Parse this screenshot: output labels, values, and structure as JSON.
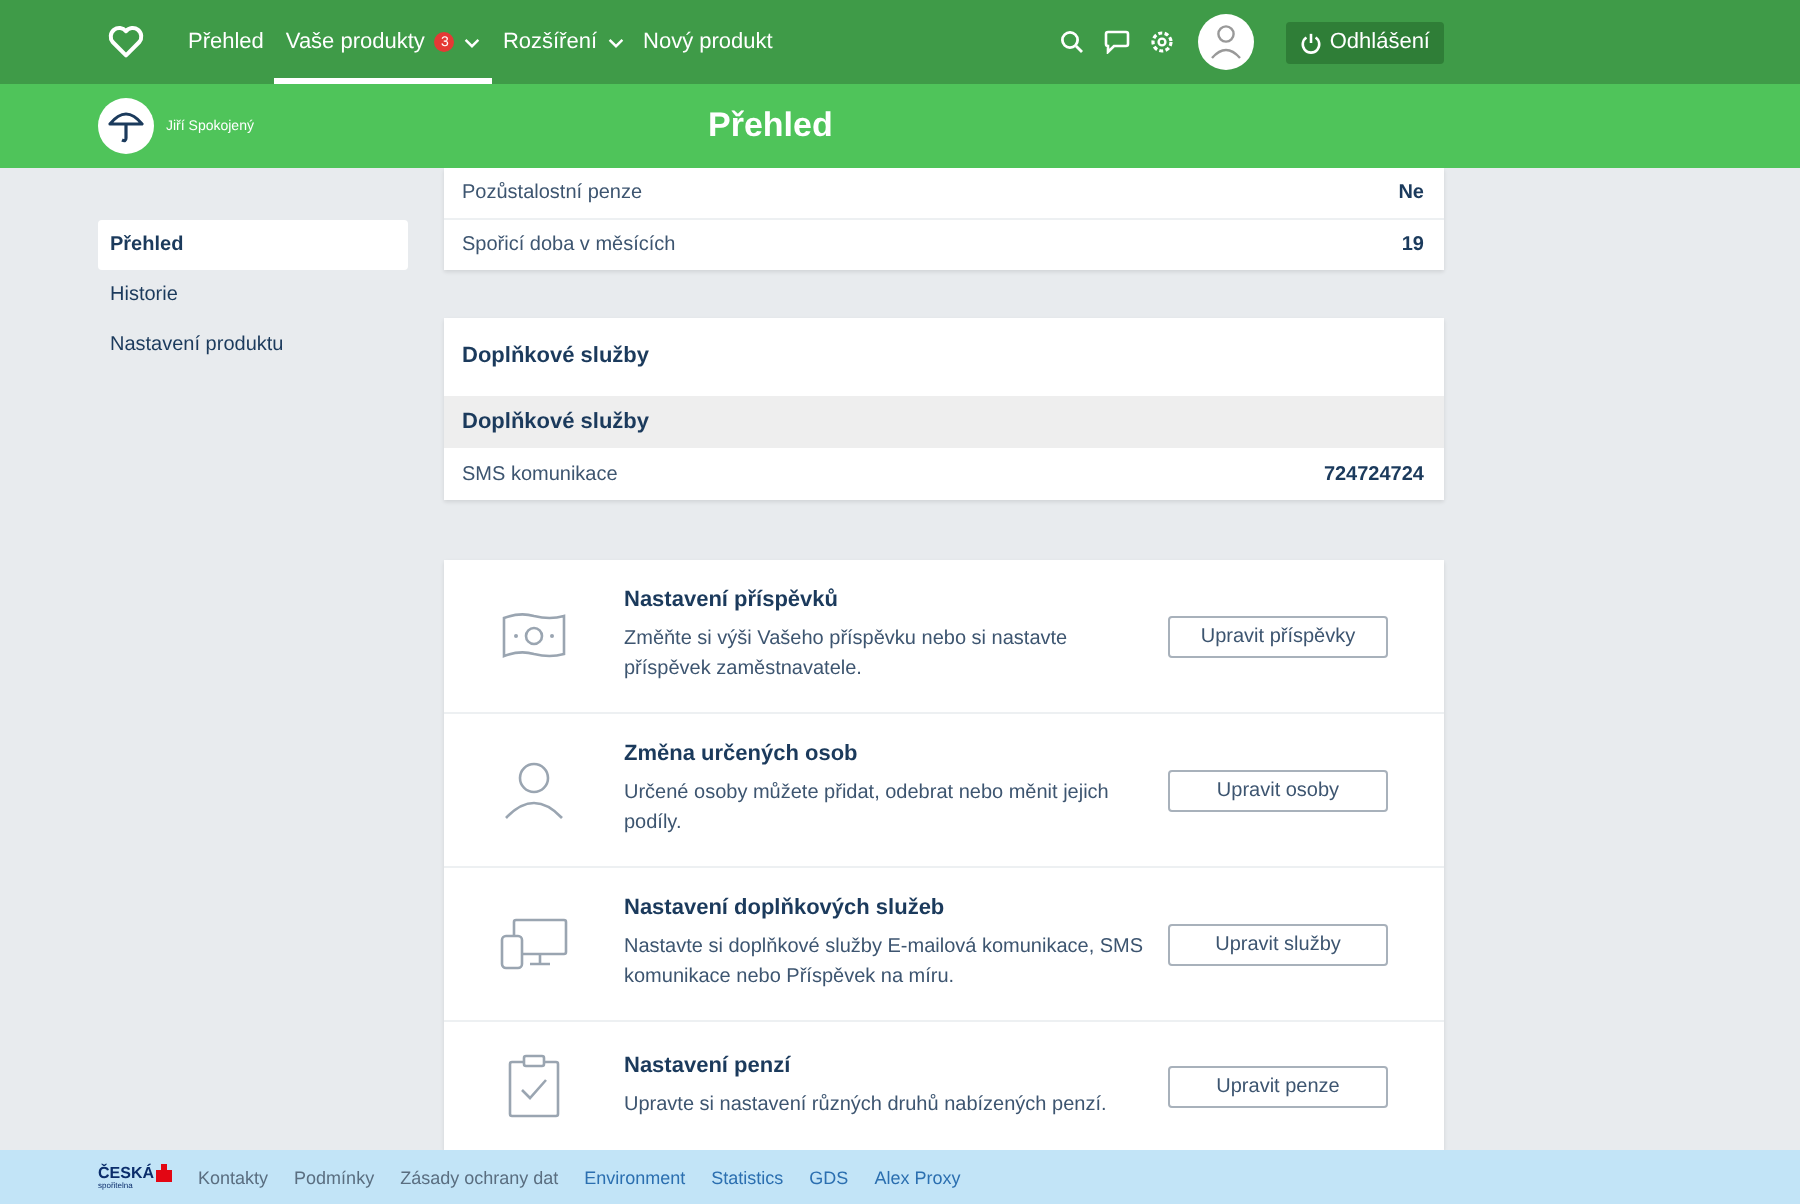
{
  "nav": {
    "items": [
      {
        "label": "Přehled",
        "selected": false,
        "has_menu": false
      },
      {
        "label": "Vaše produkty",
        "selected": true,
        "badge": "3",
        "has_menu": true
      },
      {
        "label": "Rozšíření",
        "selected": false,
        "has_menu": true
      },
      {
        "label": "Nový produkt",
        "selected": false,
        "has_menu": false
      }
    ],
    "logout": "Odhlášení"
  },
  "header": {
    "user": "Jiří Spokojený",
    "title": "Přehled"
  },
  "sidebar": {
    "items": [
      {
        "label": "Přehled",
        "selected": true
      },
      {
        "label": "Historie",
        "selected": false
      },
      {
        "label": "Nastavení produktu",
        "selected": false
      }
    ]
  },
  "summary_rows": [
    {
      "label": "Pozůstalostní penze",
      "value": "Ne"
    },
    {
      "label": "Spořicí doba v měsících",
      "value": "19"
    }
  ],
  "services": {
    "title": "Doplňkové služby",
    "group": "Doplňkové služby",
    "rows": [
      {
        "label": "SMS komunikace",
        "value": "724724724"
      }
    ]
  },
  "actions": [
    {
      "kind": "money",
      "title": "Nastavení příspěvků",
      "text": "Změňte si výši Vašeho příspěvku nebo si nastavte příspěvek zaměstnavatele.",
      "button": "Upravit příspěvky"
    },
    {
      "kind": "person",
      "title": "Změna určených osob",
      "text": "Určené osoby můžete přidat, odebrat nebo měnit jejich podíly.",
      "button": "Upravit osoby"
    },
    {
      "kind": "devices",
      "title": "Nastavení doplňkových služeb",
      "text": "Nastavte si doplňkové služby E-mailová komunikace, SMS komunikace nebo Příspěvek na míru.",
      "button": "Upravit služby"
    },
    {
      "kind": "clipboard",
      "title": "Nastavení penzí",
      "text": "Upravte si nastavení různých druhů nabízených penzí.",
      "button": "Upravit penze"
    }
  ],
  "footer": {
    "logo": "ČESKÁ",
    "logo_sub": "spořitelna",
    "links": [
      {
        "label": "Kontakty",
        "highlighted": false
      },
      {
        "label": "Podmínky",
        "highlighted": false
      },
      {
        "label": "Zásady ochrany dat",
        "highlighted": false
      },
      {
        "label": "Environment",
        "highlighted": true
      },
      {
        "label": "Statistics",
        "highlighted": true
      },
      {
        "label": "GDS",
        "highlighted": true
      },
      {
        "label": "Alex Proxy",
        "highlighted": true
      }
    ]
  }
}
